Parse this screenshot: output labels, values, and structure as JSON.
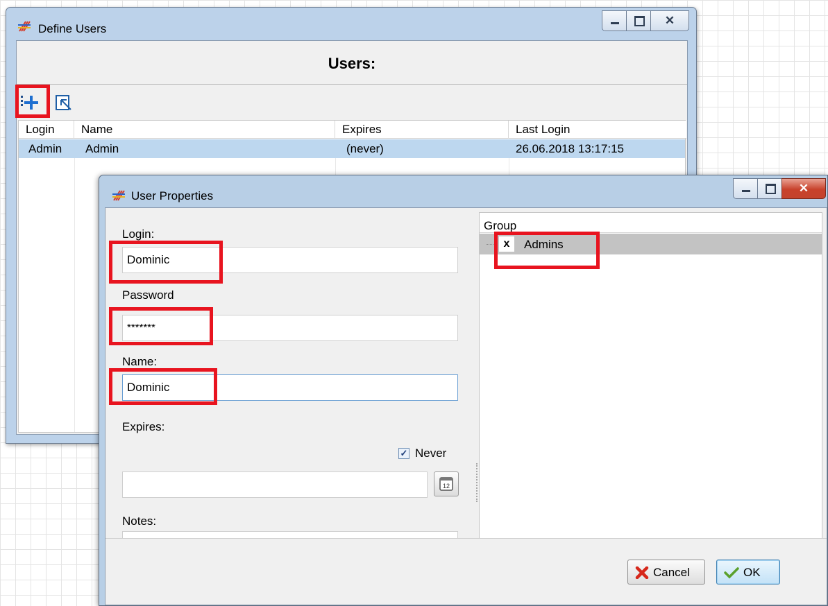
{
  "define_users": {
    "title": "Define Users",
    "header": "Users:",
    "columns": [
      "Login",
      "Name",
      "Expires",
      "Last Login"
    ],
    "rows": [
      {
        "login": "Admin",
        "name": "Admin",
        "expires": "(never)",
        "last_login": "26.06.2018 13:17:15"
      }
    ]
  },
  "user_properties": {
    "title": "User Properties",
    "login_label": "Login:",
    "login_value": "Dominic",
    "password_label": "Password",
    "password_value": "*******",
    "name_label": "Name:",
    "name_value": "Dominic",
    "expires_label": "Expires:",
    "expires_value": "",
    "never_label": "Never",
    "never_checked": true,
    "notes_label": "Notes:",
    "notes_value": "",
    "group_header": "Group",
    "groups": [
      {
        "mark": "x",
        "name": "Admins"
      }
    ],
    "cancel_label": "Cancel",
    "ok_label": "OK"
  },
  "icons": {
    "app": "app-logo-icon",
    "add_user": "add-user-icon",
    "edit_user": "edit-user-icon",
    "calendar": "calendar-icon",
    "cancel": "cancel-x-icon",
    "ok": "checkmark-icon"
  },
  "colors": {
    "highlight": "#e8141f",
    "selected_row": "#bdd7ef",
    "window_frame": "#bcd2ea",
    "close_button": "#c8412b"
  }
}
